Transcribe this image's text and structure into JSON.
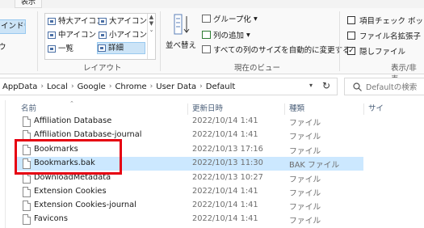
{
  "ribbon": {
    "tabs": {
      "view": "表示"
    },
    "panes": {
      "nav_pane_label": "インドウ",
      "details_label": "ウ"
    },
    "layout": {
      "items": [
        "特大アイコン",
        "大アイコン",
        "中アイコン",
        "小アイコン",
        "一覧",
        "詳細"
      ],
      "selected": "詳細",
      "group_label": "レイアウト"
    },
    "current_view": {
      "sort_label": "並べ替え",
      "group_by": "グループ化",
      "add_column": "列の追加",
      "fit_columns": "すべての列のサイズを自動的に変更する",
      "group_label": "現在のビュー"
    },
    "show_hide": {
      "item_checkboxes": "項目チェック ボックス",
      "file_extensions": "ファイル名拡張子",
      "hidden_items": "隠しファイル",
      "group_label": "表示/非表"
    }
  },
  "address_bar": {
    "crumbs": [
      "AppData",
      "Local",
      "Google",
      "Chrome",
      "User Data",
      "Default"
    ],
    "search_placeholder": "Defaultの検索"
  },
  "columns": {
    "name": "名前",
    "date": "更新日時",
    "type": "種類",
    "size": "サイ"
  },
  "files": [
    {
      "name": "Affiliation Database",
      "date": "2022/10/14 1:41",
      "type": "ファイル"
    },
    {
      "name": "Affiliation Database-journal",
      "date": "2022/10/14 1:41",
      "type": "ファイル"
    },
    {
      "name": "Bookmarks",
      "date": "2022/10/13 17:16",
      "type": "ファイル"
    },
    {
      "name": "Bookmarks.bak",
      "date": "2022/10/13 11:30",
      "type": "BAK ファイル"
    },
    {
      "name": "DownloadMetadata",
      "date": "2022/10/13 10:27",
      "type": "ファイル"
    },
    {
      "name": "Extension Cookies",
      "date": "2022/10/14 1:41",
      "type": "ファイル"
    },
    {
      "name": "Extension Cookies-journal",
      "date": "2022/10/14 1:41",
      "type": "ファイル"
    },
    {
      "name": "Favicons",
      "date": "2022/10/14 1:41",
      "type": "ファイル"
    }
  ],
  "colors": {
    "selection": "#cce8ff",
    "highlight_box": "#e60012",
    "header_text": "#4c607a"
  },
  "icons": [
    "sort-icon",
    "group-by-icon",
    "add-column-icon",
    "fit-columns-icon",
    "refresh-icon",
    "search-icon",
    "file-icon"
  ]
}
